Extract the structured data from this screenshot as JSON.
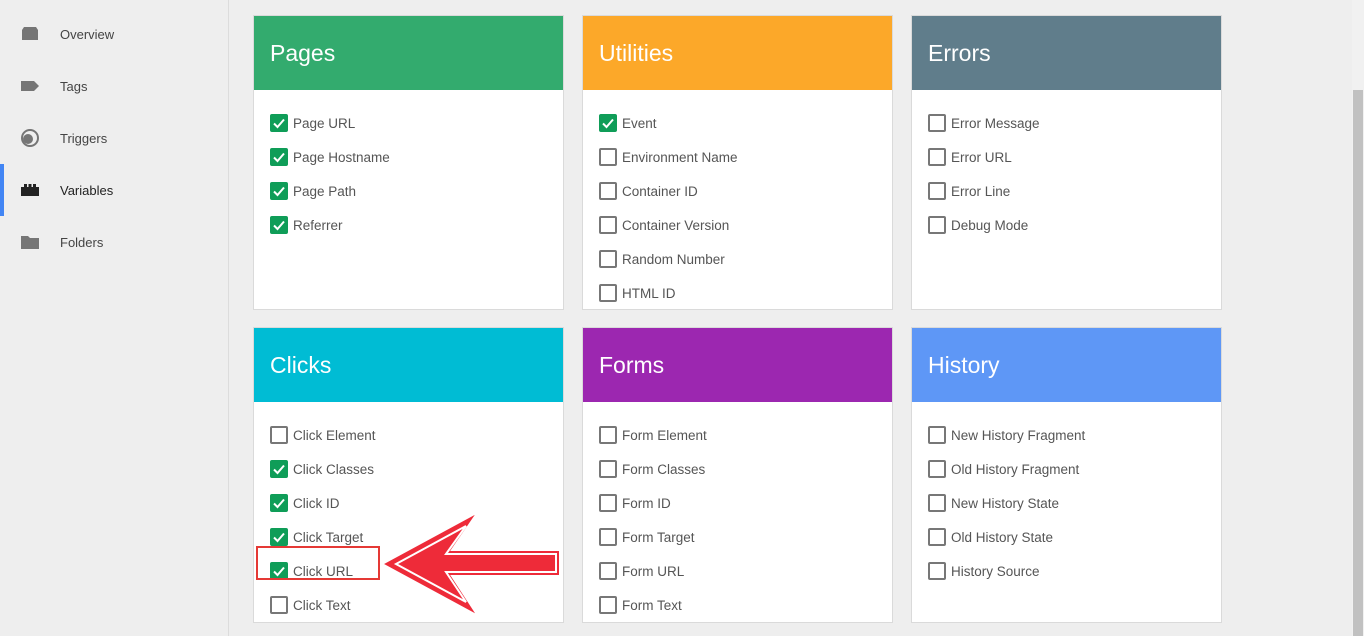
{
  "sidebar": {
    "items": [
      {
        "label": "Overview",
        "icon": "overview-icon",
        "active": false
      },
      {
        "label": "Tags",
        "icon": "tag-icon",
        "active": false
      },
      {
        "label": "Triggers",
        "icon": "trigger-icon",
        "active": false
      },
      {
        "label": "Variables",
        "icon": "variables-icon",
        "active": true
      },
      {
        "label": "Folders",
        "icon": "folder-icon",
        "active": false
      }
    ],
    "accent": "#4285f4"
  },
  "cards": [
    {
      "title": "Pages",
      "color": "#33ab6e",
      "items": [
        {
          "label": "Page URL",
          "checked": true
        },
        {
          "label": "Page Hostname",
          "checked": true
        },
        {
          "label": "Page Path",
          "checked": true
        },
        {
          "label": "Referrer",
          "checked": true
        }
      ]
    },
    {
      "title": "Utilities",
      "color": "#fca829",
      "items": [
        {
          "label": "Event",
          "checked": true
        },
        {
          "label": "Environment Name",
          "checked": false
        },
        {
          "label": "Container ID",
          "checked": false
        },
        {
          "label": "Container Version",
          "checked": false
        },
        {
          "label": "Random Number",
          "checked": false
        },
        {
          "label": "HTML ID",
          "checked": false
        }
      ]
    },
    {
      "title": "Errors",
      "color": "#607d8b",
      "items": [
        {
          "label": "Error Message",
          "checked": false
        },
        {
          "label": "Error URL",
          "checked": false
        },
        {
          "label": "Error Line",
          "checked": false
        },
        {
          "label": "Debug Mode",
          "checked": false
        }
      ]
    },
    {
      "title": "Clicks",
      "color": "#00bcd4",
      "items": [
        {
          "label": "Click Element",
          "checked": false
        },
        {
          "label": "Click Classes",
          "checked": true
        },
        {
          "label": "Click ID",
          "checked": true
        },
        {
          "label": "Click Target",
          "checked": true
        },
        {
          "label": "Click URL",
          "checked": true
        },
        {
          "label": "Click Text",
          "checked": false
        }
      ]
    },
    {
      "title": "Forms",
      "color": "#9c27b0",
      "items": [
        {
          "label": "Form Element",
          "checked": false
        },
        {
          "label": "Form Classes",
          "checked": false
        },
        {
          "label": "Form ID",
          "checked": false
        },
        {
          "label": "Form Target",
          "checked": false
        },
        {
          "label": "Form URL",
          "checked": false
        },
        {
          "label": "Form Text",
          "checked": false
        }
      ]
    },
    {
      "title": "History",
      "color": "#5e97f6",
      "items": [
        {
          "label": "New History Fragment",
          "checked": false
        },
        {
          "label": "Old History Fragment",
          "checked": false
        },
        {
          "label": "New History State",
          "checked": false
        },
        {
          "label": "Old History State",
          "checked": false
        },
        {
          "label": "History Source",
          "checked": false
        }
      ]
    }
  ],
  "check_color": "#0f9d58",
  "annotation_color": "#e53935"
}
